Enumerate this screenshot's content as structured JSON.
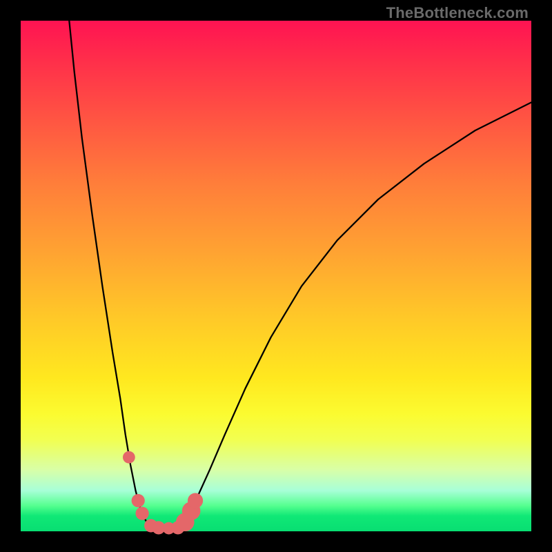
{
  "watermark": "TheBottleneck.com",
  "chart_data": {
    "type": "line",
    "title": "",
    "xlabel": "",
    "ylabel": "",
    "xlim": [
      0,
      100
    ],
    "ylim": [
      0,
      100
    ],
    "curve_left": {
      "x": [
        9.5,
        10.5,
        12,
        14,
        16,
        18,
        19.5,
        20.5,
        21.5,
        22.5,
        23.2,
        24,
        25,
        26
      ],
      "y": [
        100,
        90,
        77,
        62,
        48,
        35,
        26,
        19,
        13,
        8,
        5.2,
        3,
        1.2,
        0.5
      ]
    },
    "curve_right": {
      "x": [
        31,
        32.5,
        34.5,
        37,
        40,
        44,
        49,
        55,
        62,
        70,
        79,
        89,
        100
      ],
      "y": [
        0.5,
        2.2,
        6.5,
        12,
        19,
        28,
        38,
        48,
        57,
        65,
        72,
        78.5,
        84
      ]
    },
    "flat_bottom": {
      "x": [
        26,
        31
      ],
      "y": [
        0.5,
        0.5
      ]
    },
    "markers": [
      {
        "x": 21.2,
        "y": 14.5,
        "r": 1.2
      },
      {
        "x": 23.0,
        "y": 6.0,
        "r": 1.3
      },
      {
        "x": 23.8,
        "y": 3.5,
        "r": 1.3
      },
      {
        "x": 25.5,
        "y": 1.1,
        "r": 1.3
      },
      {
        "x": 27.0,
        "y": 0.7,
        "r": 1.3
      },
      {
        "x": 29.0,
        "y": 0.6,
        "r": 1.2
      },
      {
        "x": 30.8,
        "y": 0.7,
        "r": 1.3
      },
      {
        "x": 32.2,
        "y": 1.8,
        "r": 1.8
      },
      {
        "x": 33.4,
        "y": 4.0,
        "r": 1.8
      },
      {
        "x": 34.2,
        "y": 6.0,
        "r": 1.5
      }
    ]
  }
}
